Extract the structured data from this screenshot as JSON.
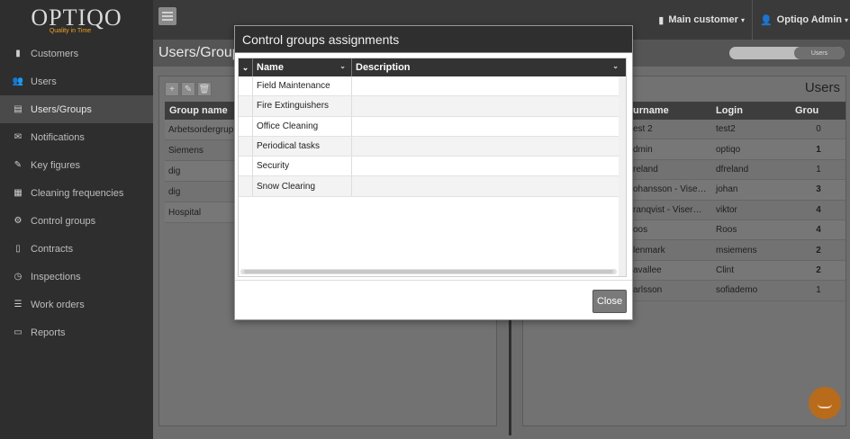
{
  "brand": {
    "logo": "OPTIQO",
    "tagline": "Quality in Time"
  },
  "sidebar": {
    "items": [
      {
        "label": "Customers",
        "icon": "briefcase-icon"
      },
      {
        "label": "Users",
        "icon": "users-icon"
      },
      {
        "label": "Users/Groups",
        "icon": "id-card-icon",
        "active": true
      },
      {
        "label": "Notifications",
        "icon": "envelope-icon"
      },
      {
        "label": "Key figures",
        "icon": "pencil-icon"
      },
      {
        "label": "Cleaning frequencies",
        "icon": "calendar-icon"
      },
      {
        "label": "Control groups",
        "icon": "gears-icon"
      },
      {
        "label": "Contracts",
        "icon": "document-icon"
      },
      {
        "label": "Inspections",
        "icon": "clock-icon"
      },
      {
        "label": "Work orders",
        "icon": "list-icon"
      },
      {
        "label": "Reports",
        "icon": "monitor-icon"
      }
    ]
  },
  "topbar": {
    "customer": "Main customer",
    "user": "Optiqo Admin"
  },
  "page": {
    "title": "Users/Group",
    "toggle_label": "Users",
    "users_title": "Users"
  },
  "groups": {
    "header": "Group name",
    "rows": [
      "Arbetsordergrup",
      "Siemens",
      "dig",
      "dig",
      "Hospital"
    ]
  },
  "users": {
    "headers": [
      "urname",
      "Login",
      "Grou"
    ],
    "rows": [
      [
        "est 2",
        "test2",
        "0"
      ],
      [
        "dmin",
        "optiqo",
        "1"
      ],
      [
        "reland",
        "dfreland",
        "1"
      ],
      [
        "ohansson - Vise…",
        "johan",
        "3"
      ],
      [
        "ranqvist - Viser…",
        "viktor",
        "4"
      ],
      [
        "oos",
        "Roos",
        "4"
      ],
      [
        "lenmark",
        "msiemens",
        "2"
      ],
      [
        "avallee",
        "Clint",
        "2"
      ],
      [
        "arlsson",
        "sofiademo",
        "1"
      ]
    ]
  },
  "modal": {
    "title": "Control groups assignments",
    "col_name": "Name",
    "col_desc": "Description",
    "rows": [
      "Field Maintenance",
      "Fire Extinguishers",
      "Office Cleaning",
      "Periodical tasks",
      "Security",
      "Snow Clearing"
    ],
    "close_label": "Close"
  },
  "colors": {
    "accent": "#f0a020",
    "header": "#333333"
  }
}
